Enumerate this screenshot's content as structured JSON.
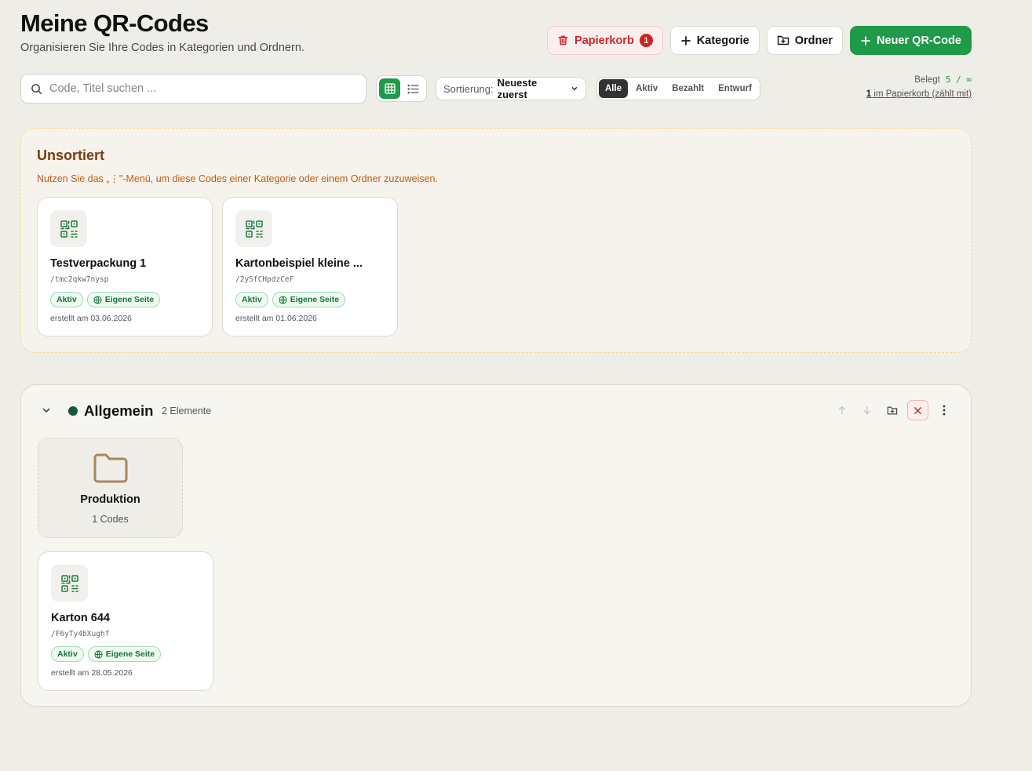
{
  "header": {
    "title": "Meine QR-Codes",
    "subtitle": "Organisieren Sie Ihre Codes in Kategorien und Ordnern."
  },
  "actions": {
    "trash_label": "Papierkorb",
    "trash_count": "1",
    "category_label": "Kategorie",
    "folder_label": "Ordner",
    "new_label": "Neuer QR-Code"
  },
  "search": {
    "placeholder": "Code, Titel suchen ..."
  },
  "view": {
    "active": "grid"
  },
  "sort": {
    "label": "Sortierung:",
    "value": "Neueste zuerst"
  },
  "filters": [
    "Alle",
    "Aktiv",
    "Bezahlt",
    "Entwurf"
  ],
  "usage": {
    "label": "Belegt",
    "value": "5 / ∞",
    "trash_count": "1",
    "trash_text": " im Papierkorb (zählt mit)"
  },
  "unsorted": {
    "title": "Unsortiert",
    "hint": "Nutzen Sie das „⋮\"-Menü, um diese Codes einer Kategorie oder einem Ordner zuzuweisen.",
    "cards": [
      {
        "title": "Testverpackung 1",
        "slug": "/tmc2qkw7nysp",
        "status": "Aktiv",
        "type": "Eigene Seite",
        "date": "erstellt am 03.06.2026"
      },
      {
        "title": "Kartonbeispiel kleine ...",
        "slug": "/2ySfCHpdzCeF",
        "status": "Aktiv",
        "type": "Eigene Seite",
        "date": "erstellt am 01.06.2026"
      }
    ]
  },
  "category": {
    "title": "Allgemein",
    "count": "2 Elemente",
    "color": "#14593d",
    "folder": {
      "name": "Produktion",
      "count": "1 Codes"
    },
    "cards": [
      {
        "title": "Karton 644",
        "slug": "/F6yTy4bXughf",
        "status": "Aktiv",
        "type": "Eigene Seite",
        "date": "erstellt am 28.05.2026"
      }
    ]
  },
  "colors": {
    "accent": "#1f9a48",
    "danger": "#d32121",
    "warning": "#c25b13"
  }
}
